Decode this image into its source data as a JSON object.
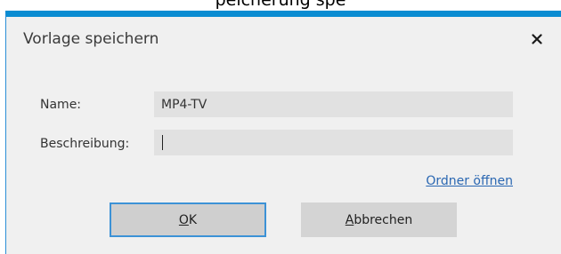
{
  "top_fragment": {
    "text": "peicherung spe"
  },
  "dialog": {
    "title": "Vorlage speichern",
    "close_icon": "close-icon",
    "accent_color": "#0a8cd2"
  },
  "form": {
    "name_label": "Name:",
    "name_value": "MP4-TV",
    "description_label": "Beschreibung:",
    "description_value": ""
  },
  "links": {
    "open_folder": "Ordner öffnen"
  },
  "buttons": {
    "ok_mnemonic": "O",
    "ok_rest": "K",
    "cancel_mnemonic": "A",
    "cancel_rest": "bbrechen"
  }
}
